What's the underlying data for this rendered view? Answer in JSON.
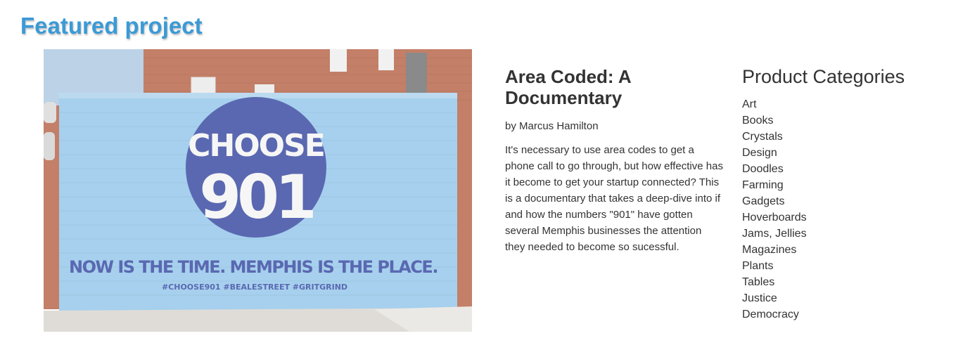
{
  "section": {
    "title": "Featured project"
  },
  "hero_image": {
    "headline_line1": "CHOOSE",
    "headline_line2": "901",
    "tagline": "NOW IS THE TIME. MEMPHIS IS THE PLACE.",
    "hashtags": "#CHOOSE901  #BEALESTREET  #GRITGRIND",
    "colors": {
      "wall": "#8ec3e8",
      "circle": "#2c3e9c",
      "brick": "#b05a3c",
      "sky": "#9fbfdc"
    }
  },
  "project": {
    "title": "Area Coded: A Documentary",
    "author": "by Marcus Hamilton",
    "description": "It's necessary to use area codes to get a phone call to go through, but how effective has it become to get your startup connected? This is a documentary that takes a deep-dive into if and how the numbers \"901\" have gotten several Memphis businesses the attention they needed to become so sucessful."
  },
  "categories": {
    "title": "Product Categories",
    "items": [
      "Art",
      "Books",
      "Crystals",
      "Design",
      "Doodles",
      "Farming",
      "Gadgets",
      "Hoverboards",
      "Jams, Jellies",
      "Magazines",
      "Plants",
      "Tables",
      "Justice",
      "Democracy"
    ]
  },
  "colors": {
    "accent": "#3b9ad6",
    "text": "#333333"
  }
}
